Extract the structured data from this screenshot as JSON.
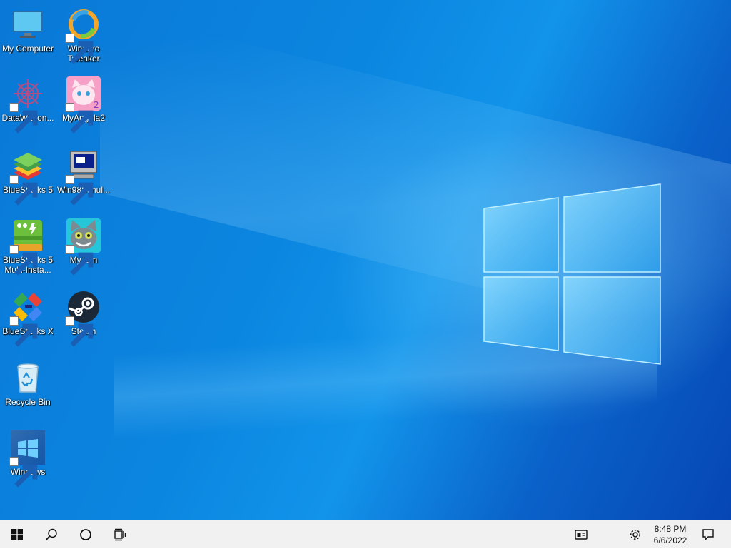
{
  "desktop": {
    "icons": [
      {
        "label": "My Computer",
        "icon": "monitor-icon",
        "shortcut": false
      },
      {
        "label": "Winaero\nTweaker",
        "icon": "winaero-tweaker-icon",
        "shortcut": true
      },
      {
        "label": "DataWagon...",
        "icon": "datawagon-icon",
        "shortcut": true
      },
      {
        "label": "MyAngela2",
        "icon": "my-angela-icon",
        "shortcut": true
      },
      {
        "label": "BlueStacks 5",
        "icon": "bluestacks-icon",
        "shortcut": true
      },
      {
        "label": "Win98Simul...",
        "icon": "win98-simulator-icon",
        "shortcut": true
      },
      {
        "label": "BlueStacks 5\nMulti-Insta...",
        "icon": "bluestacks-multi-instance-icon",
        "shortcut": true
      },
      {
        "label": "MyTom",
        "icon": "my-tom-icon",
        "shortcut": true
      },
      {
        "label": "BlueStacks X",
        "icon": "bluestacks-x-icon",
        "shortcut": true
      },
      {
        "label": "Steam",
        "icon": "steam-icon",
        "shortcut": true
      },
      {
        "label": "Recycle Bin",
        "icon": "recycle-bin-icon",
        "shortcut": false
      },
      {
        "label": "Windows",
        "icon": "windows-icon",
        "shortcut": true
      }
    ]
  },
  "taskbar": {
    "buttons": [
      "start-icon",
      "search-icon",
      "cortana-icon",
      "task-view-icon"
    ],
    "tray": [
      "news-widget-icon",
      "settings-icon",
      "notification-icon"
    ],
    "clock": {
      "time": "8:48 PM",
      "date": "6/6/2022"
    }
  },
  "colors": {
    "wallpaper": "#0a78d6",
    "taskbar": "#f1f1f1",
    "label_text": "#ffffff"
  }
}
